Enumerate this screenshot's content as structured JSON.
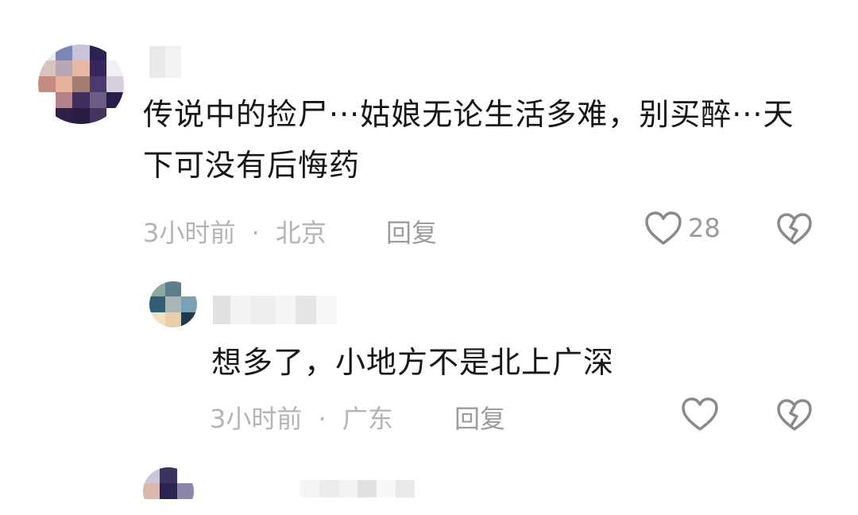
{
  "comments": [
    {
      "text": "传说中的捡尸···姑娘无论生活多难，别买醉···天下可没有后悔药",
      "time": "3小时前",
      "location": "北京",
      "reply_label": "回复",
      "likes": "28"
    },
    {
      "text": "想多了，小地方不是北上广深",
      "time": "3小时前",
      "location": "广东",
      "reply_label": "回复"
    }
  ],
  "separator": "·",
  "icons": {
    "like": "heart-outline-icon",
    "dislike": "broken-heart-icon"
  },
  "colors": {
    "text": "#161616",
    "meta": "#b4b4b4",
    "icon": "#8a8a8a"
  }
}
